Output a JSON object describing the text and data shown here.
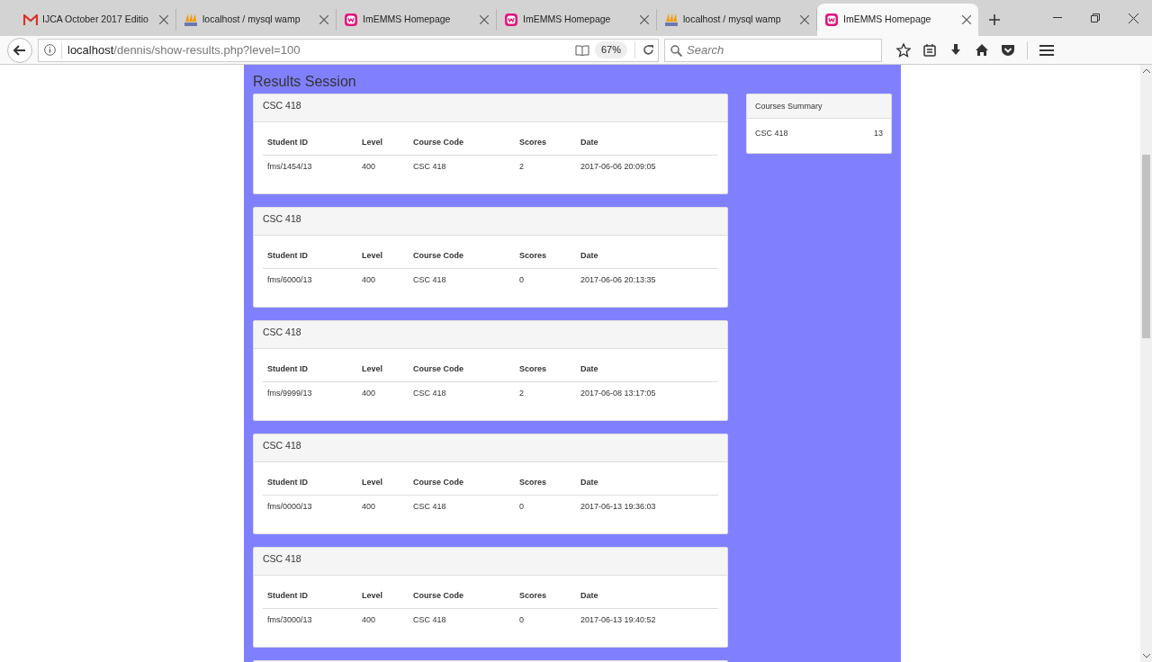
{
  "browser": {
    "tabs": [
      {
        "title": "IJCA October 2017 Editio",
        "kind": "gmail",
        "selected": false
      },
      {
        "title": "localhost / mysql wamp",
        "kind": "pma",
        "selected": false
      },
      {
        "title": "ImEMMS Homepage",
        "kind": "wamp",
        "selected": false
      },
      {
        "title": "ImEMMS Homepage",
        "kind": "wamp",
        "selected": false
      },
      {
        "title": "localhost / mysql wamp",
        "kind": "pma",
        "selected": false
      },
      {
        "title": "ImEMMS Homepage",
        "kind": "wamp",
        "selected": true
      }
    ],
    "url_host": "localhost",
    "url_path": "/dennis/show-results.php?level=100",
    "zoom": "67%",
    "search": {
      "placeholder": "Search"
    }
  },
  "page": {
    "title": "Results Session",
    "results": [
      {
        "heading": "CSC 418",
        "columns": [
          "Student ID",
          "Level",
          "Course Code",
          "Scores",
          "Date"
        ],
        "row": [
          "fms/1454/13",
          "400",
          "CSC 418",
          "2",
          "2017-06-06 20:09:05"
        ]
      },
      {
        "heading": "CSC 418",
        "columns": [
          "Student ID",
          "Level",
          "Course Code",
          "Scores",
          "Date"
        ],
        "row": [
          "fms/6000/13",
          "400",
          "CSC 418",
          "0",
          "2017-06-06 20:13:35"
        ]
      },
      {
        "heading": "CSC 418",
        "columns": [
          "Student ID",
          "Level",
          "Course Code",
          "Scores",
          "Date"
        ],
        "row": [
          "fms/9999/13",
          "400",
          "CSC 418",
          "2",
          "2017-06-08 13:17:05"
        ]
      },
      {
        "heading": "CSC 418",
        "columns": [
          "Student ID",
          "Level",
          "Course Code",
          "Scores",
          "Date"
        ],
        "row": [
          "fms/0000/13",
          "400",
          "CSC 418",
          "0",
          "2017-06-13 19:36:03"
        ]
      },
      {
        "heading": "CSC 418",
        "columns": [
          "Student ID",
          "Level",
          "Course Code",
          "Scores",
          "Date"
        ],
        "row": [
          "fms/3000/13",
          "400",
          "CSC 418",
          "0",
          "2017-06-13 19:40:52"
        ]
      }
    ],
    "summary": {
      "title": "Courses Summary",
      "rows": [
        {
          "course": "CSC 418",
          "count": "13"
        }
      ]
    }
  }
}
